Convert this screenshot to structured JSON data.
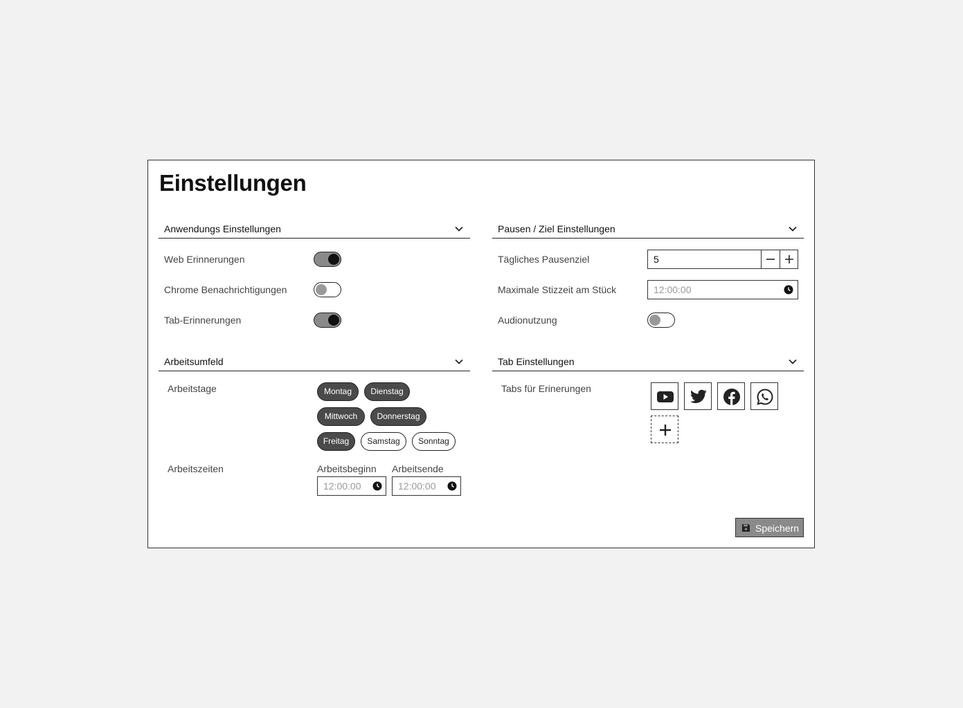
{
  "title": "Einstellungen",
  "app_settings": {
    "header": "Anwendungs Einstellungen",
    "rows": [
      {
        "label": "Web Erinnerungen",
        "enabled": true
      },
      {
        "label": "Chrome Benachrichtigungen",
        "enabled": false
      },
      {
        "label": "Tab-Erinnerungen",
        "enabled": true
      }
    ]
  },
  "pause_settings": {
    "header": "Pausen / Ziel Einstellungen",
    "daily_goal": {
      "label": "Tägliches Pausenziel",
      "value": "5"
    },
    "max_sitting": {
      "label": "Maximale Stizzeit am Stück",
      "placeholder": "12:00:00"
    },
    "audio": {
      "label": "Audionutzung",
      "enabled": false
    }
  },
  "work_env": {
    "header": "Arbeitsumfeld",
    "days_label": "Arbeitstage",
    "days": [
      {
        "label": "Montag",
        "selected": true
      },
      {
        "label": "Dienstag",
        "selected": true
      },
      {
        "label": "Mittwoch",
        "selected": true
      },
      {
        "label": "Donnerstag",
        "selected": true
      },
      {
        "label": "Freitag",
        "selected": true
      },
      {
        "label": "Samstag",
        "selected": false
      },
      {
        "label": "Sonntag",
        "selected": false
      }
    ],
    "times_label": "Arbeitszeiten",
    "start": {
      "label": "Arbeitsbeginn",
      "placeholder": "12:00:00"
    },
    "end": {
      "label": "Arbeitsende",
      "placeholder": "12:00:00"
    }
  },
  "tab_settings": {
    "header": "Tab Einstellungen",
    "label": "Tabs für Erinerungen",
    "tabs": [
      "youtube-icon",
      "twitter-icon",
      "facebook-icon",
      "whatsapp-icon"
    ],
    "add_icon": "plus-icon"
  },
  "save_label": "Speichern",
  "colors": {
    "background": "#f2f2f2",
    "panel": "#ffffff",
    "toggle_on": "#8a8a8a",
    "chip_selected": "#4a4a4a",
    "save_button": "#8a8a8a"
  }
}
